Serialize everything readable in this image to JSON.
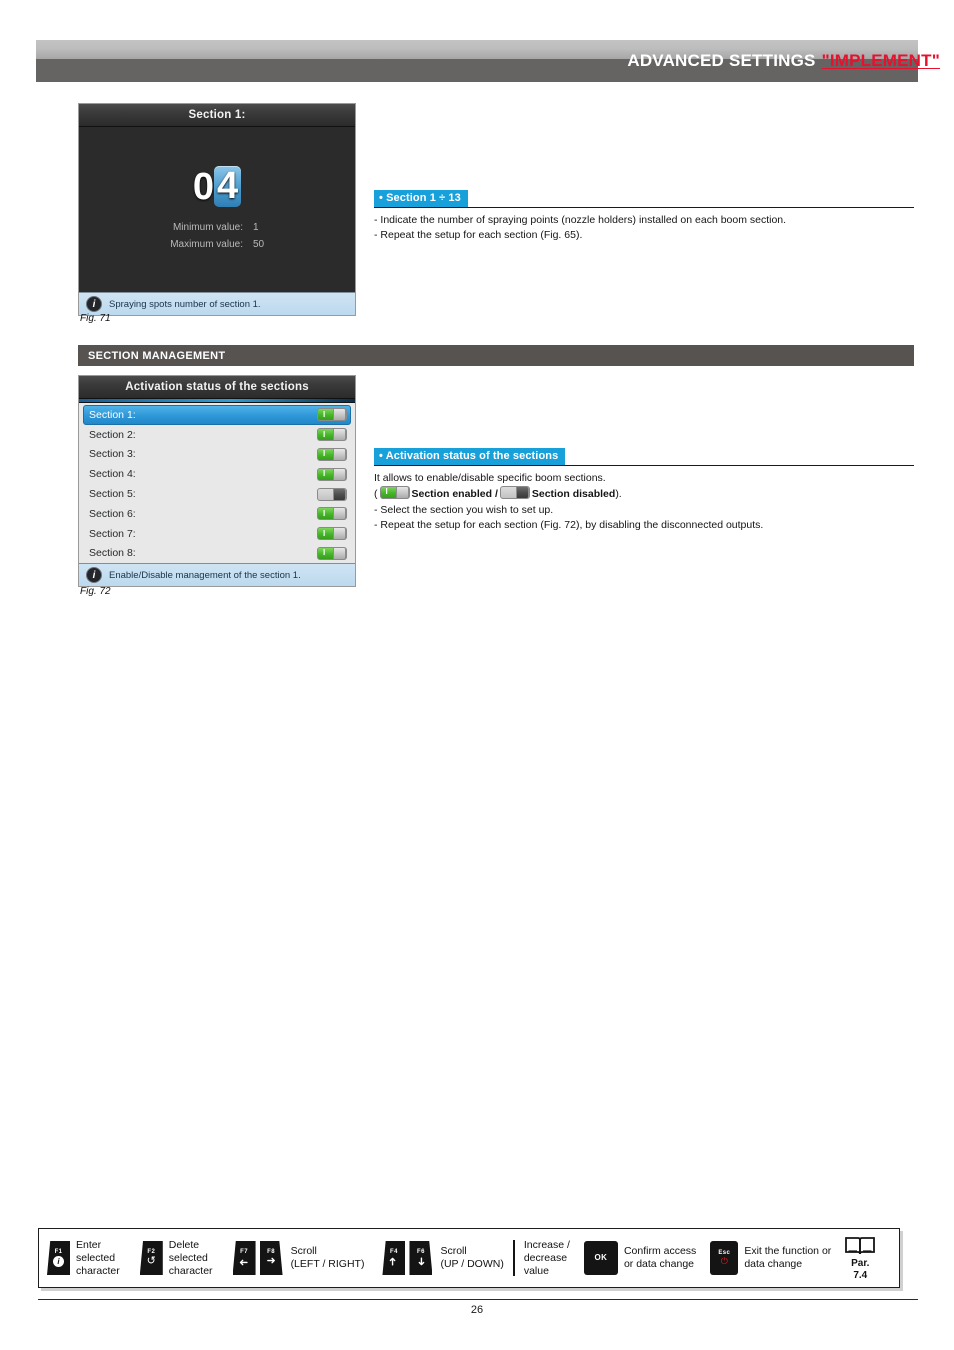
{
  "header": {
    "title_main": "ADVANCED SETTINGS",
    "title_accent": "\"IMPLEMENT\""
  },
  "figure_71": {
    "caption": "Fig. 71",
    "screen": {
      "title": "Section 1:",
      "value_prefix": "0",
      "value_selected_digit": "4",
      "minimum_label": "Minimum value:",
      "minimum_value": "1",
      "maximum_label": "Maximum value:",
      "maximum_value": "50",
      "info_icon": "info-circle-icon",
      "info_text": "Spraying spots number of section 1."
    }
  },
  "block_section_range": {
    "heading": "• Section 1 ÷ 13",
    "lines": [
      "- Indicate the number of spraying points (nozzle holders) installed on each boom section.",
      "- Repeat the setup for each section (Fig. 65)."
    ]
  },
  "section_band": {
    "label": "SECTION MANAGEMENT"
  },
  "figure_72": {
    "caption": "Fig. 72",
    "screen": {
      "title": "Activation status of the sections",
      "rows": [
        {
          "label": "Section 1:",
          "state": "on",
          "selected": true
        },
        {
          "label": "Section 2:",
          "state": "on",
          "selected": false
        },
        {
          "label": "Section 3:",
          "state": "on",
          "selected": false
        },
        {
          "label": "Section 4:",
          "state": "on",
          "selected": false
        },
        {
          "label": "Section 5:",
          "state": "off",
          "selected": false
        },
        {
          "label": "Section 6:",
          "state": "on",
          "selected": false
        },
        {
          "label": "Section 7:",
          "state": "on",
          "selected": false
        },
        {
          "label": "Section 8:",
          "state": "on",
          "selected": false
        }
      ],
      "info_icon": "info-circle-icon",
      "info_text": "Enable/Disable management of the section 1."
    }
  },
  "block_activation": {
    "heading": "• Activation status of the sections",
    "line1": "It allows to enable/disable specific boom sections.",
    "legend_open": "(",
    "legend_enabled": "Section enabled",
    "legend_sep": "/",
    "legend_disabled": "Section disabled",
    "legend_close": ").",
    "line3": "- Select the section you wish to set up.",
    "line4": "- Repeat the setup for each section (Fig. 72), by disabling the disconnected outputs."
  },
  "legend_bar": {
    "items": [
      {
        "key_label": "F1",
        "key_icon": "info-circle-icon",
        "text": "Enter\nselected\ncharacter"
      },
      {
        "key_label": "F2",
        "key_icon": "delete-loop-icon",
        "text": "Delete\nselected\ncharacter"
      },
      {
        "key_label_a": "F7",
        "key_icon_a": "arrow-left-icon",
        "key_label_b": "F8",
        "key_icon_b": "arrow-right-icon",
        "text": "Scroll\n(LEFT / RIGHT)"
      },
      {
        "key_label_a": "F4",
        "key_icon_a": "arrow-up-icon",
        "key_label_b": "F6",
        "key_icon_b": "arrow-down-icon",
        "text": "Scroll\n(UP / DOWN)"
      },
      {
        "text": "Increase /\ndecrease\nvalue"
      },
      {
        "key_label": "OK",
        "text": "Confirm access\nor data change"
      },
      {
        "key_label": "Esc",
        "key_icon": "power-icon",
        "text": "Exit the function or\ndata change"
      }
    ],
    "reference": {
      "icon": "open-book-icon",
      "line1": "Par.",
      "line2": "7.4"
    }
  },
  "footer": {
    "page_number": "26"
  },
  "colors": {
    "accent_blue": "#18a0db",
    "accent_red": "#e8112d",
    "band_gray": "#565351",
    "toggle_on_green": "#46b52a"
  }
}
